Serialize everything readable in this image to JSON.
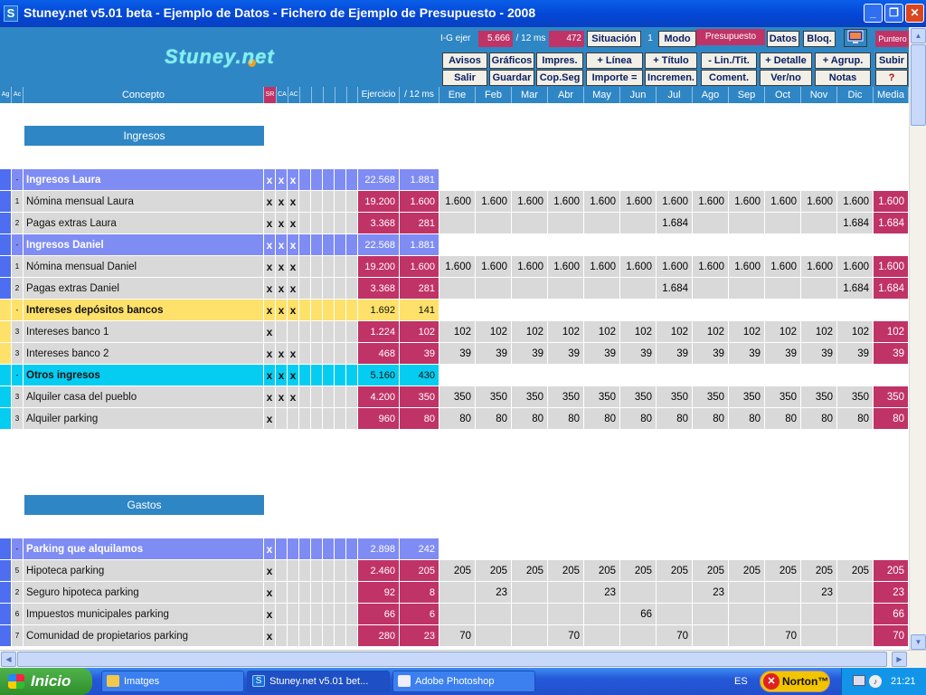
{
  "window": {
    "title": "Stuney.net v5.01 beta - Ejemplo de Datos - Fichero de Ejemplo de Presupuesto - 2008",
    "icon": "S"
  },
  "header": {
    "logo": "Stuney.net",
    "stats": {
      "label1": "I-G ejer",
      "value1": "5.666",
      "label2": "/ 12 ms",
      "value2": "472",
      "sit_value": "1",
      "mode_value": "Presupuesto"
    },
    "buttons": {
      "situacion": "Situación",
      "modo": "Modo",
      "datos": "Datos",
      "bloq": "Bloq.",
      "puntero": "Puntero",
      "avisos": "Avisos",
      "graficos": "Gráficos",
      "impres": "Impres.",
      "mas_linea": "+ Línea",
      "mas_titulo": "+ Título",
      "menos_lin": "- Lin./Tit.",
      "mas_detalle": "+ Detalle",
      "mas_agrup": "+ Agrup.",
      "subir": "Subir",
      "salir": "Salir",
      "guardar": "Guardar",
      "copseg": "Cop.Seg",
      "importe": "Importe =",
      "incremen": "Incremen.",
      "coment": "Coment.",
      "verno": "Ver/no",
      "notas": "Notas",
      "ayuda": "?"
    }
  },
  "columns": {
    "ag": "Ag",
    "ac": "Ac",
    "concepto": "Concepto",
    "sr": "SR",
    "ca": "CA",
    "ac2": "AC",
    "ejercicio": "Ejercicio",
    "doce": "/ 12 ms",
    "months": [
      "Ene",
      "Feb",
      "Mar",
      "Abr",
      "May",
      "Jun",
      "Jul",
      "Ago",
      "Sep",
      "Oct",
      "Nov",
      "Dic"
    ],
    "media": "Media"
  },
  "sections": {
    "ingresos": "Ingresos",
    "gastos": "Gastos"
  },
  "rows": [
    {
      "kind": "group",
      "color": "blue",
      "ag": "",
      "ac": "-",
      "label": "Ingresos Laura",
      "x": [
        "x",
        "x",
        "x"
      ],
      "ej": "22.568",
      "doce": "1.881"
    },
    {
      "kind": "line",
      "ag": "",
      "ac": "1",
      "label": "Nómina mensual Laura",
      "x": [
        "x",
        "x",
        "x"
      ],
      "ej": "19.200",
      "doce": "1.600",
      "m": [
        "1.600",
        "1.600",
        "1.600",
        "1.600",
        "1.600",
        "1.600",
        "1.600",
        "1.600",
        "1.600",
        "1.600",
        "1.600",
        "1.600"
      ],
      "media": "1.600"
    },
    {
      "kind": "line",
      "ag": "",
      "ac": "2",
      "label": "Pagas extras Laura",
      "x": [
        "x",
        "x",
        "x"
      ],
      "ej": "3.368",
      "doce": "281",
      "m": [
        "",
        "",
        "",
        "",
        "",
        "",
        "1.684",
        "",
        "",
        "",
        "",
        "1.684"
      ],
      "media": "1.684"
    },
    {
      "kind": "group",
      "color": "blue",
      "ag": "",
      "ac": "-",
      "label": "Ingresos Daniel",
      "x": [
        "x",
        "x",
        "x"
      ],
      "ej": "22.568",
      "doce": "1.881"
    },
    {
      "kind": "line",
      "ag": "",
      "ac": "1",
      "label": "Nómina mensual Daniel",
      "x": [
        "x",
        "x",
        "x"
      ],
      "ej": "19.200",
      "doce": "1.600",
      "m": [
        "1.600",
        "1.600",
        "1.600",
        "1.600",
        "1.600",
        "1.600",
        "1.600",
        "1.600",
        "1.600",
        "1.600",
        "1.600",
        "1.600"
      ],
      "media": "1.600"
    },
    {
      "kind": "line",
      "ag": "",
      "ac": "2",
      "label": "Pagas extras Daniel",
      "x": [
        "x",
        "x",
        "x"
      ],
      "ej": "3.368",
      "doce": "281",
      "m": [
        "",
        "",
        "",
        "",
        "",
        "",
        "1.684",
        "",
        "",
        "",
        "",
        "1.684"
      ],
      "media": "1.684"
    },
    {
      "kind": "group",
      "color": "yellow",
      "ag": "",
      "ac": "-",
      "label": "Intereses depósitos bancos",
      "x": [
        "x",
        "x",
        "x"
      ],
      "ej": "1.692",
      "doce": "141"
    },
    {
      "kind": "line",
      "ag": "",
      "ac": "3",
      "label": "Intereses banco 1",
      "x": [
        "x",
        "",
        ""
      ],
      "ej": "1.224",
      "doce": "102",
      "m": [
        "102",
        "102",
        "102",
        "102",
        "102",
        "102",
        "102",
        "102",
        "102",
        "102",
        "102",
        "102"
      ],
      "media": "102"
    },
    {
      "kind": "line",
      "ag": "",
      "ac": "3",
      "label": "Intereses banco 2",
      "x": [
        "x",
        "x",
        "x"
      ],
      "ej": "468",
      "doce": "39",
      "m": [
        "39",
        "39",
        "39",
        "39",
        "39",
        "39",
        "39",
        "39",
        "39",
        "39",
        "39",
        "39"
      ],
      "media": "39"
    },
    {
      "kind": "group",
      "color": "cyan",
      "ag": "",
      "ac": "-",
      "label": "Otros ingresos",
      "x": [
        "x",
        "x",
        "x"
      ],
      "ej": "5.160",
      "doce": "430"
    },
    {
      "kind": "line",
      "ag": "",
      "ac": "3",
      "label": "Alquiler casa del pueblo",
      "x": [
        "x",
        "x",
        "x"
      ],
      "ej": "4.200",
      "doce": "350",
      "m": [
        "350",
        "350",
        "350",
        "350",
        "350",
        "350",
        "350",
        "350",
        "350",
        "350",
        "350",
        "350"
      ],
      "media": "350"
    },
    {
      "kind": "line",
      "ag": "",
      "ac": "3",
      "label": "Alquiler parking",
      "x": [
        "x",
        "",
        ""
      ],
      "ej": "960",
      "doce": "80",
      "m": [
        "80",
        "80",
        "80",
        "80",
        "80",
        "80",
        "80",
        "80",
        "80",
        "80",
        "80",
        "80"
      ],
      "media": "80"
    },
    {
      "kind": "group",
      "color": "blue",
      "ag": "",
      "ac": "-",
      "label": "Parking que alquilamos",
      "x": [
        "x",
        "",
        ""
      ],
      "ej": "2.898",
      "doce": "242"
    },
    {
      "kind": "line",
      "ag": "",
      "ac": "5",
      "label": "Hipoteca parking",
      "x": [
        "x",
        "",
        ""
      ],
      "ej": "2.460",
      "doce": "205",
      "m": [
        "205",
        "205",
        "205",
        "205",
        "205",
        "205",
        "205",
        "205",
        "205",
        "205",
        "205",
        "205"
      ],
      "media": "205"
    },
    {
      "kind": "line",
      "ag": "",
      "ac": "2",
      "label": "Seguro hipoteca parking",
      "x": [
        "x",
        "",
        ""
      ],
      "ej": "92",
      "doce": "8",
      "m": [
        "",
        "23",
        "",
        "",
        "23",
        "",
        "",
        "23",
        "",
        "",
        "23",
        ""
      ],
      "media": "23"
    },
    {
      "kind": "line",
      "ag": "",
      "ac": "6",
      "label": "Impuestos municipales parking",
      "x": [
        "x",
        "",
        ""
      ],
      "ej": "66",
      "doce": "6",
      "m": [
        "",
        "",
        "",
        "",
        "",
        "66",
        "",
        "",
        "",
        "",
        "",
        ""
      ],
      "media": "66"
    },
    {
      "kind": "line",
      "ag": "",
      "ac": "7",
      "label": "Comunidad de propietarios parking",
      "x": [
        "x",
        "",
        ""
      ],
      "ej": "280",
      "doce": "23",
      "m": [
        "70",
        "",
        "",
        "70",
        "",
        "",
        "70",
        "",
        "",
        "70",
        "",
        ""
      ],
      "media": "70"
    }
  ],
  "taskbar": {
    "start": "Inicio",
    "tasks": [
      "Imatges",
      "Stuney.net v5.01 bet...",
      "Adobe Photoshop"
    ],
    "lang": "ES",
    "norton": "Norton™",
    "clock": "21:21"
  },
  "colors": {
    "header_blue": "#2f86c5",
    "group_blue": "#7f8cf4",
    "group_yellow": "#fde16a",
    "group_cyan": "#05cdf1",
    "line_gray": "#d9d9d9",
    "value_red": "#c03366",
    "accent_side": "#4d6ef0"
  }
}
